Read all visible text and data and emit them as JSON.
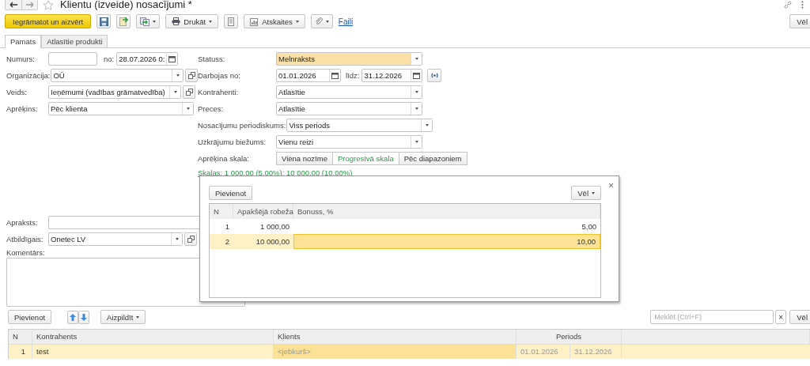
{
  "window": {
    "title": "Klientu (izveide) nosacījumi *"
  },
  "toolbar": {
    "primary": "Iegrāmatot un aizvērt",
    "print": "Drukāt",
    "reports": "Atskaites",
    "files_link": "Faili",
    "more": "Vēl"
  },
  "tabs": [
    {
      "label": "Pamats",
      "selected": true
    },
    {
      "label": "Atlasītie produkti",
      "selected": false
    }
  ],
  "numurs": {
    "label": "Numurs:",
    "date_label": "no:",
    "date": "28.07.2026  0:"
  },
  "left_fields": [
    {
      "label": "Organizācija:",
      "value": "OÜ",
      "kind": "combo_open"
    },
    {
      "label": "Veids:",
      "value": "Ieņēmumi (vadības grāmatvedība)",
      "kind": "combo_open"
    },
    {
      "label": "Aprēķins:",
      "value": "Pēc klienta",
      "kind": "combo"
    }
  ],
  "right_fields": [
    {
      "label": "Statuss:",
      "value": "Melnraksts",
      "kind": "combo",
      "highlighted": true
    },
    {
      "label": "Darbojas no:",
      "value": "01.01.2026",
      "to_label": "līdz:",
      "to_value": "31.12.2026",
      "kind": "period"
    },
    {
      "label": "Kontrahenti:",
      "value": "Atlasītie",
      "kind": "combo",
      "highlighted": false
    },
    {
      "label": "Preces:",
      "value": "Atlasītie",
      "kind": "combo",
      "highlighted": false
    },
    {
      "label": "Nosacījumu periodiskums:",
      "value": "Viss periods",
      "kind": "combo",
      "highlighted": false
    },
    {
      "label": "Uzkrājumu biežums:",
      "value": "Vienu reizi",
      "kind": "combo",
      "highlighted": false
    }
  ],
  "scale": {
    "label": "Aprēķina skala:",
    "options": [
      {
        "label": "Viena nozīme",
        "selected": false
      },
      {
        "label": "Progresīvā skala",
        "selected": true
      },
      {
        "label": "Pēc diapazoniem",
        "selected": false
      }
    ],
    "link": "Skalas: 1 000,00 (5,00%); 10 000,00 (10,00%)"
  },
  "apraksts": {
    "label": "Apraksts:"
  },
  "atbildigais": {
    "label": "Atbildīgais:",
    "value": "Onetec LV"
  },
  "komentars": {
    "label": "Komentārs:"
  },
  "table_toolbar": {
    "add": "Pievienot",
    "fill": "Aizpildīt",
    "search_placeholder": "Meklēt (Ctrl+F)",
    "clear": "×",
    "more": "Vēl"
  },
  "table": {
    "columns": [
      "N",
      "Kontrahents",
      "Klients",
      "Periods"
    ],
    "rows": [
      {
        "n": "1",
        "kontrahents": "test",
        "klients": "<jebkurš>",
        "period_from": "01.01.2026",
        "period_to": "31.12.2026",
        "selected": true
      }
    ]
  },
  "popup": {
    "add": "Pievienot",
    "more": "Vēl",
    "close": "×",
    "columns": [
      "N",
      "Apakšējā robeža",
      "Bonuss, %"
    ],
    "rows": [
      {
        "n": "1",
        "limit": "1 000,00",
        "bonus": "5,00",
        "selected": false
      },
      {
        "n": "2",
        "limit": "10 000,00",
        "bonus": "10,00",
        "selected": true
      }
    ]
  }
}
